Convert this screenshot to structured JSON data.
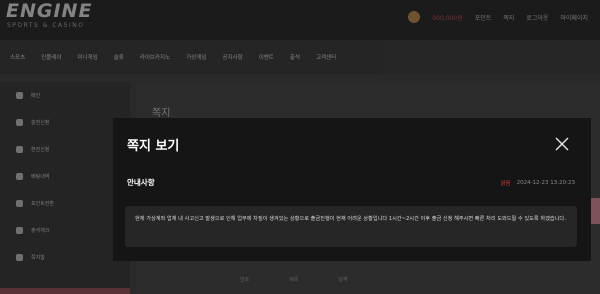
{
  "site": {
    "logo": "ENGINE",
    "logo_sub": "SPORTS & CASINO",
    "top_items": [
      "000,000원",
      "포인트",
      "쪽지",
      "로그아웃",
      "마이페이지"
    ],
    "nav": [
      "스포츠",
      "인플레이",
      "미니게임",
      "슬롯",
      "라이브카지노",
      "가상게임",
      "공지사항",
      "이벤트",
      "출석",
      "고객센터"
    ],
    "sidebar": [
      "메인",
      "충전신청",
      "환전신청",
      "배팅내역",
      "포인트전환",
      "출석체크",
      "쪽지함"
    ],
    "content_title": "쪽지",
    "content_row": [
      "번호",
      "제목",
      "날짜"
    ]
  },
  "modal": {
    "title": "쪽지 보기",
    "notice_label": "안내사항",
    "read_status": "읽음",
    "timestamp": "2024-12-23 13:20:23",
    "message": "현재 가상계좌 업체 내 사고신고 발생으로 인해 업무에 차질이 생겨있는 상황으로 출금진행이 현재 어려운 상황입니다 1시간~2시간 이후 출금 신청 해주시면 빠른 처리 도와드릴 수 있도록 하겠습니다."
  },
  "colors": {
    "accent_red": "#d43c3c",
    "modal_bg": "#151515",
    "msg_box_bg": "#262626"
  },
  "icons": {
    "close": "close-icon"
  }
}
